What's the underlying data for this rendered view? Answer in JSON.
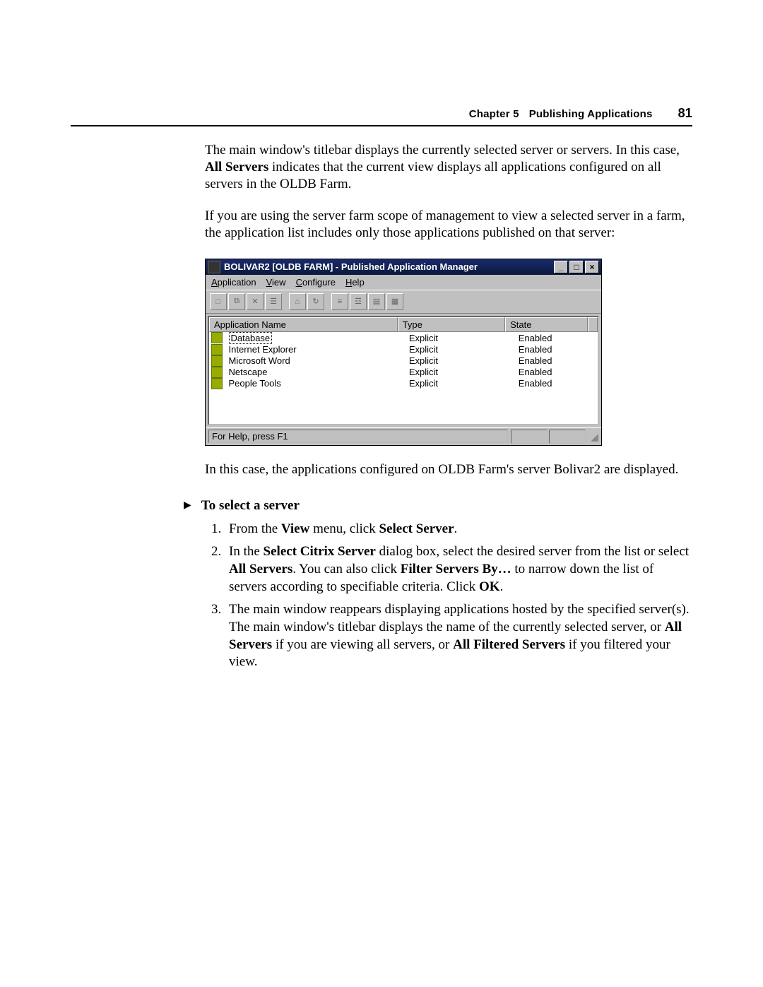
{
  "header": {
    "chapter": "Chapter 5",
    "title": "Publishing Applications",
    "page": "81"
  },
  "paras": {
    "p1a": "The main window's titlebar displays the currently selected server or servers. In this case, ",
    "p1b": "All Servers",
    "p1c": " indicates that the current view displays all applications configured on all servers in the OLDB Farm.",
    "p2": "If you are using the server farm scope of management to view a selected server in a farm, the application list includes only those applications published on that server:",
    "p3": "In this case, the applications configured on OLDB Farm's server Bolivar2 are displayed."
  },
  "window": {
    "title": "BOLIVAR2 [OLDB FARM] - Published Application Manager",
    "minimize": "_",
    "maximize": "□",
    "close": "×",
    "menus": {
      "application": {
        "pre": "",
        "m": "A",
        "post": "pplication"
      },
      "view": {
        "pre": "",
        "m": "V",
        "post": "iew"
      },
      "configure": {
        "pre": "",
        "m": "C",
        "post": "onfigure"
      },
      "help": {
        "pre": "",
        "m": "H",
        "post": "elp"
      }
    },
    "columns": {
      "name": {
        "pre": "",
        "m": "A",
        "post": "pplication Name"
      },
      "type": {
        "pre": "",
        "m": "T",
        "post": "ype"
      },
      "state": {
        "pre": "Stat",
        "m": "e",
        "post": ""
      }
    },
    "rows": [
      {
        "name": "Database",
        "type": "Explicit",
        "state": "Enabled",
        "selected": true
      },
      {
        "name": "Internet Explorer",
        "type": "Explicit",
        "state": "Enabled",
        "selected": false
      },
      {
        "name": "Microsoft Word",
        "type": "Explicit",
        "state": "Enabled",
        "selected": false
      },
      {
        "name": "Netscape",
        "type": "Explicit",
        "state": "Enabled",
        "selected": false
      },
      {
        "name": "People Tools",
        "type": "Explicit",
        "state": "Enabled",
        "selected": false
      }
    ],
    "status": "For Help, press F1"
  },
  "procedure": {
    "title": "To select a server",
    "steps": {
      "s1a": "From the ",
      "s1b": "View",
      "s1c": " menu, click ",
      "s1d": "Select Server",
      "s1e": ".",
      "s2a": "In the ",
      "s2b": "Select Citrix Server",
      "s2c": " dialog box, select the desired server from the list or select ",
      "s2d": "All Servers",
      "s2e": ". You can also click ",
      "s2f": "Filter Servers By…",
      "s2g": " to narrow down the list of servers according to specifiable criteria. Click ",
      "s2h": "OK",
      "s2i": ".",
      "s3a": "The main window reappears displaying applications hosted by the specified server(s). The main window's titlebar displays the name of the currently selected server, or ",
      "s3b": "All Servers",
      "s3c": " if you are viewing all servers, or ",
      "s3d": "All Filtered Servers",
      "s3e": " if you filtered your view."
    }
  }
}
